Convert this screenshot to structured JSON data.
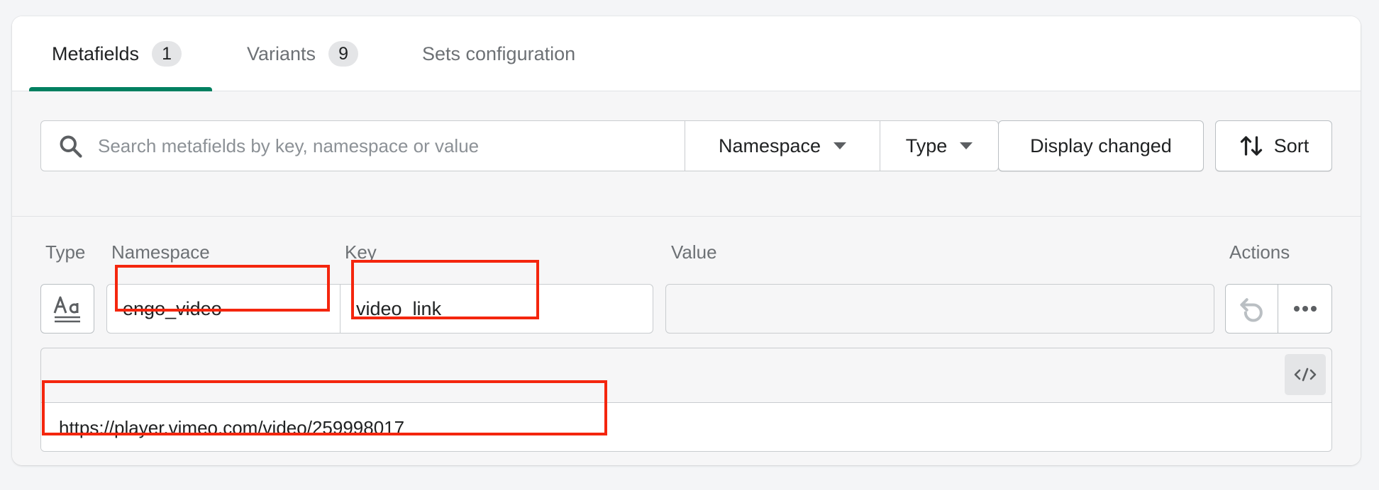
{
  "tabs": [
    {
      "label": "Metafields",
      "badge": "1"
    },
    {
      "label": "Variants",
      "badge": "9"
    },
    {
      "label": "Sets configuration"
    }
  ],
  "filters": {
    "search_placeholder": "Search metafields by key, namespace or value",
    "namespace_label": "Namespace",
    "type_label": "Type",
    "display_changed_label": "Display changed",
    "sort_label": "Sort"
  },
  "columns": {
    "type": "Type",
    "namespace": "Namespace",
    "key": "Key",
    "value": "Value",
    "actions": "Actions"
  },
  "row": {
    "namespace": "engo_video",
    "key": "video_link",
    "value": "",
    "value_text": "https://player.vimeo.com/video/259998017"
  },
  "colors": {
    "accent": "#008060",
    "highlight": "#f4260e"
  },
  "icons": {
    "search": "search-icon",
    "type": "text-type-icon",
    "sort": "sort-arrows-icon",
    "undo": "undo-icon",
    "more": "more-horizontal-icon",
    "code": "code-icon"
  }
}
